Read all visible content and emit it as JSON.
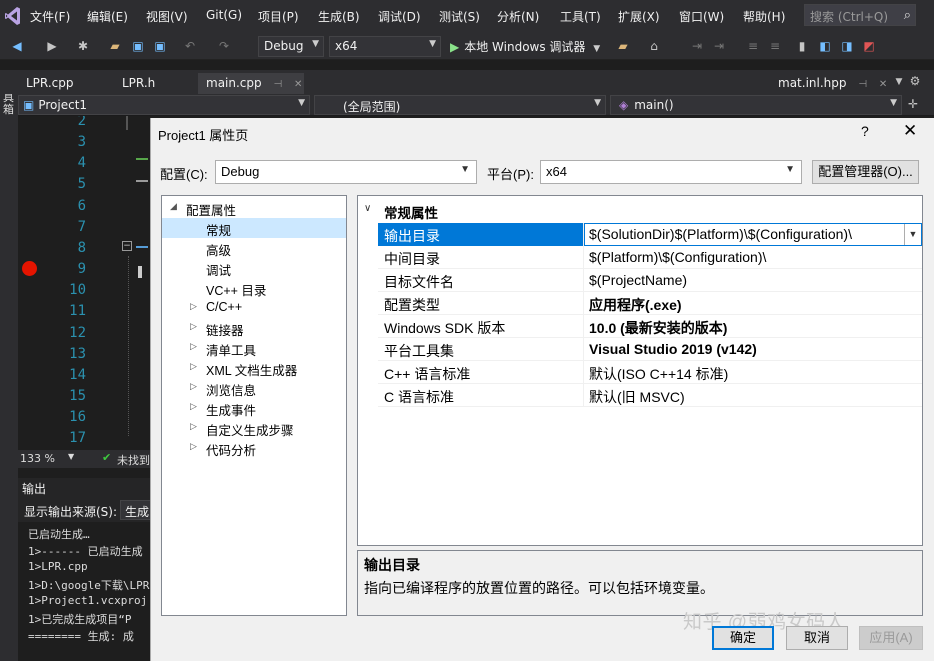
{
  "menu": {
    "items": [
      "文件(F)",
      "编辑(E)",
      "视图(V)",
      "Git(G)",
      "项目(P)",
      "生成(B)",
      "调试(D)",
      "测试(S)",
      "分析(N)",
      "工具(T)",
      "扩展(X)",
      "窗口(W)",
      "帮助(H)"
    ],
    "search_placeholder": "搜索 (Ctrl+Q)"
  },
  "toolbar": {
    "configuration": "Debug",
    "platform": "x64",
    "run_label": "本地 Windows 调试器"
  },
  "tabs": {
    "items": [
      "LPR.cpp",
      "LPR.h",
      "main.cpp"
    ],
    "right": "mat.inl.hpp"
  },
  "leftstrip": {
    "label": "工具箱"
  },
  "navbar": {
    "project": "Project1",
    "scope": "(全局范围)",
    "function": "main()"
  },
  "editor": {
    "line_numbers": [
      "2",
      "3",
      "4",
      "5",
      "6",
      "7",
      "8",
      "9",
      "10",
      "11",
      "12",
      "13",
      "14",
      "15",
      "16",
      "17"
    ],
    "zoom": "133 %",
    "status": "未找到"
  },
  "output": {
    "title": "输出",
    "source_label": "显示输出来源(S):",
    "source_value": "生成",
    "lines": [
      "已启动生成…",
      "1>------ 已启动生成",
      "1>LPR.cpp",
      "1>D:\\google下载\\LPR",
      "1>Project1.vcxproj",
      "1>已完成生成项目“P",
      "======== 生成: 成"
    ]
  },
  "dialog": {
    "title": "Project1 属性页",
    "help": "?",
    "config_label": "配置(C):",
    "config_value": "Debug",
    "platform_label": "平台(P):",
    "platform_value": "x64",
    "config_manager": "配置管理器(O)...",
    "tree": {
      "root": "配置属性",
      "children": [
        "常规",
        "高级",
        "调试",
        "VC++ 目录"
      ],
      "groups": [
        "C/C++",
        "链接器",
        "清单工具",
        "XML 文档生成器",
        "浏览信息",
        "生成事件",
        "自定义生成步骤",
        "代码分析"
      ]
    },
    "grid": {
      "category": "常规属性",
      "properties": [
        {
          "name": "输出目录",
          "value": "$(SolutionDir)$(Platform)\\$(Configuration)\\"
        },
        {
          "name": "中间目录",
          "value": "$(Platform)\\$(Configuration)\\"
        },
        {
          "name": "目标文件名",
          "value": "$(ProjectName)"
        },
        {
          "name": "配置类型",
          "value": "应用程序(.exe)"
        },
        {
          "name": "Windows SDK 版本",
          "value": "10.0 (最新安装的版本)"
        },
        {
          "name": "平台工具集",
          "value": "Visual Studio 2019 (v142)"
        },
        {
          "name": "C++ 语言标准",
          "value": "默认(ISO C++14 标准)"
        },
        {
          "name": "C 语言标准",
          "value": "默认(旧 MSVC)"
        }
      ]
    },
    "description": {
      "title": "输出目录",
      "text": "指向已编译程序的放置位置的路径。可以包括环境变量。"
    },
    "buttons": {
      "ok": "确定",
      "cancel": "取消",
      "apply": "应用(A)"
    }
  },
  "watermark": "知乎 @弱鸡女码人",
  "colors": {
    "vs_chrome": "#2d2d30",
    "editor_bg": "#1e1e1e",
    "line_number": "#2b91af",
    "breakpoint": "#e51400",
    "selection_blue": "#0078d7",
    "tree_selection": "#cce8ff",
    "dialog_bg": "#f0f0f0"
  }
}
